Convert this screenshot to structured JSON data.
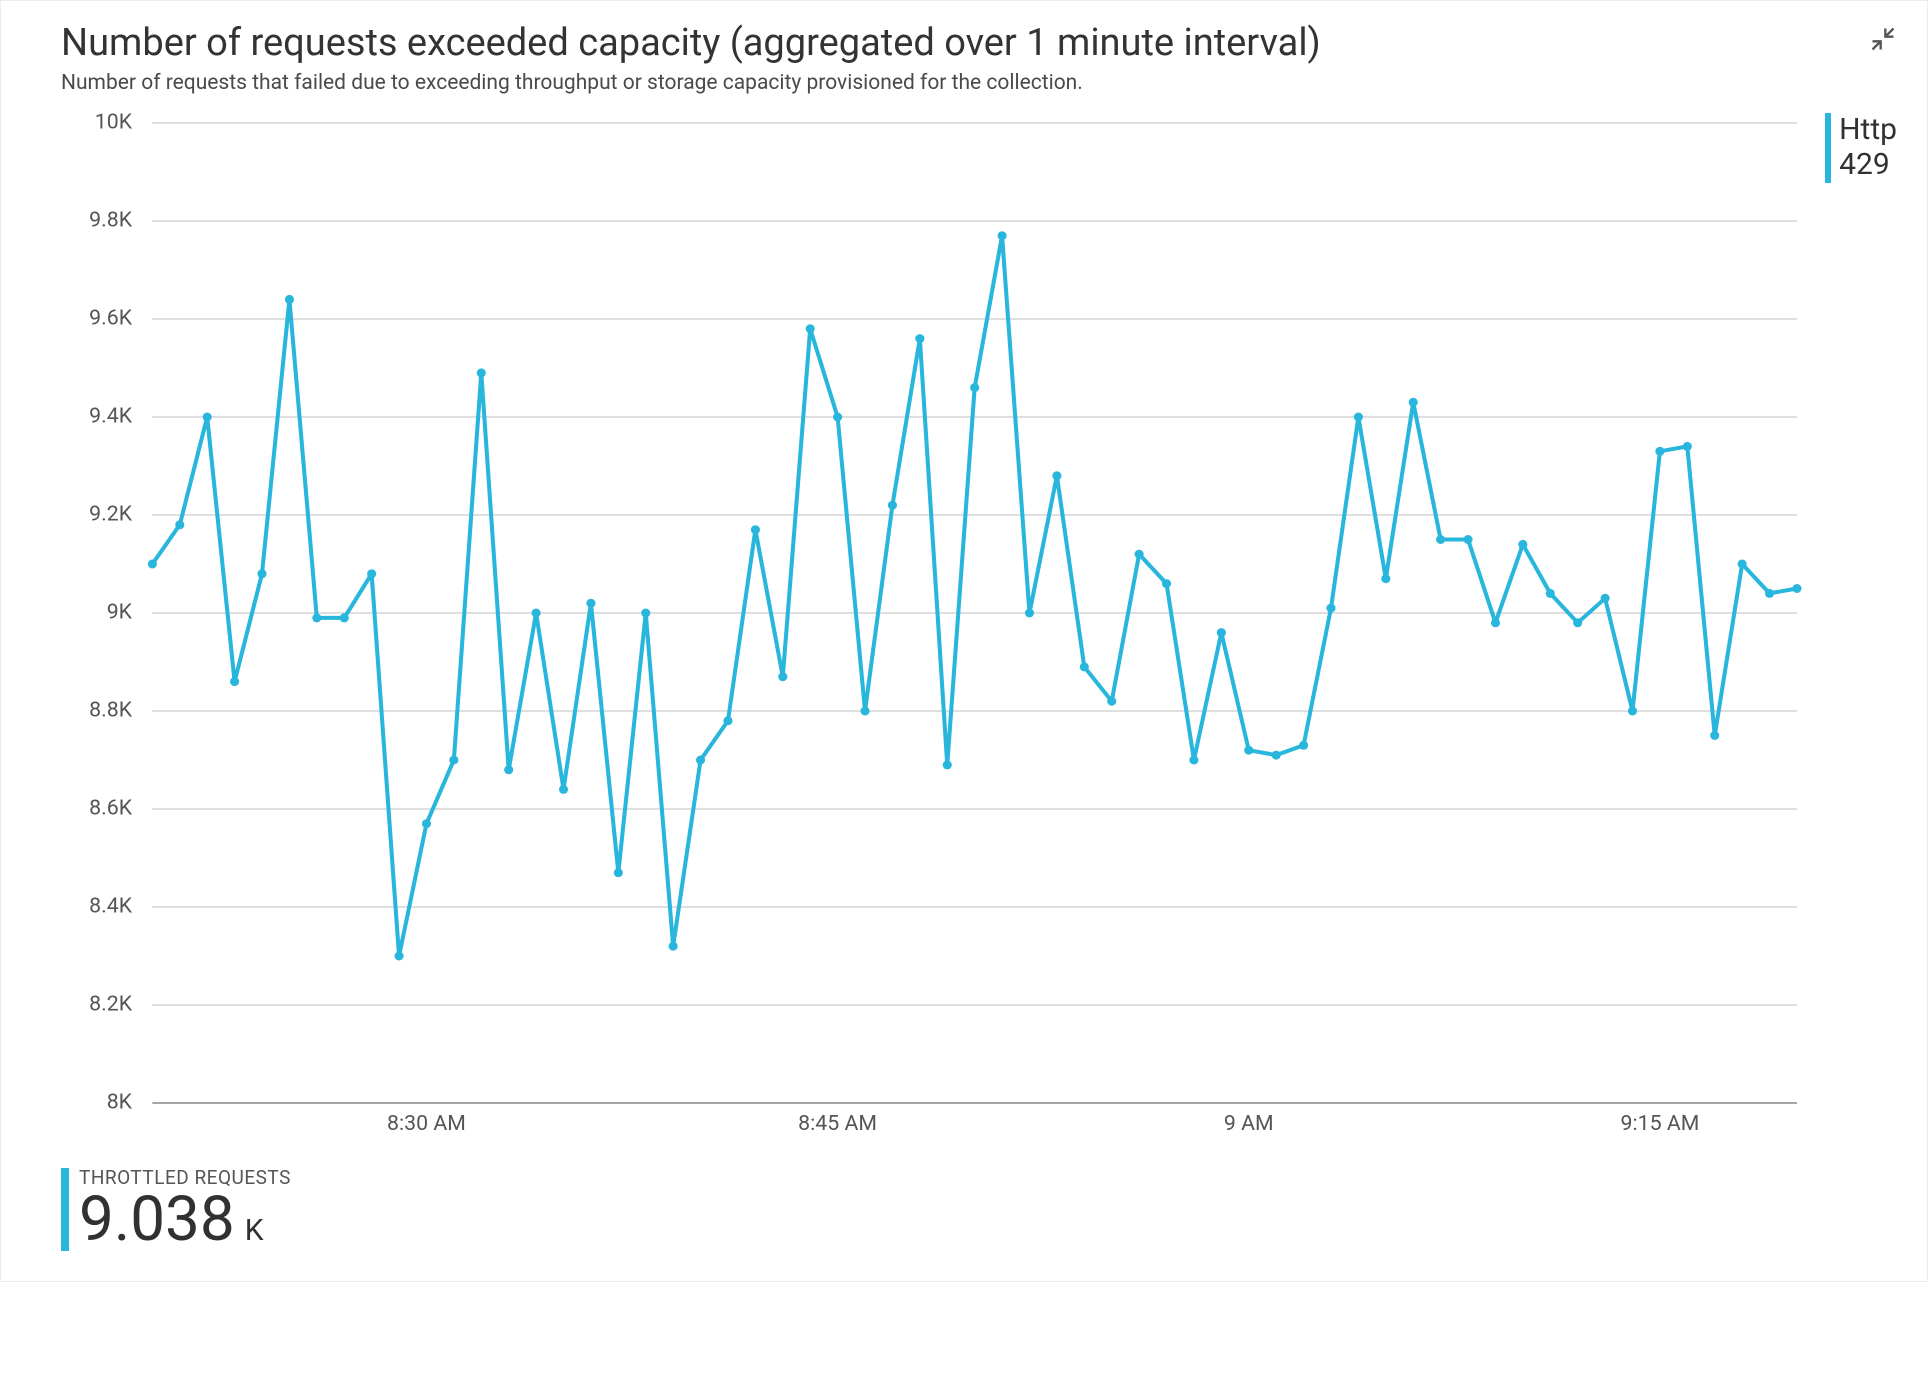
{
  "header": {
    "title": "Number of requests exceeded capacity (aggregated over 1 minute interval)",
    "subtitle": "Number of requests that failed due to exceeding throughput or storage capacity provisioned for the collection."
  },
  "legend": {
    "line1": "Http",
    "line2": "429"
  },
  "metric": {
    "label": "THROTTLED REQUESTS",
    "value": "9.038",
    "unit": "K"
  },
  "chart_data": {
    "type": "line",
    "title": "Number of requests exceeded capacity (aggregated over 1 minute interval)",
    "ylabel": "",
    "xlabel": "",
    "y_ticks": [
      8000,
      8200,
      8400,
      8600,
      8800,
      9000,
      9200,
      9400,
      9600,
      9800,
      10000
    ],
    "y_tick_labels": [
      "8K",
      "8.2K",
      "8.4K",
      "8.6K",
      "8.8K",
      "9K",
      "9.2K",
      "9.4K",
      "9.6K",
      "9.8K",
      "10K"
    ],
    "ylim": [
      8000,
      10000
    ],
    "x_ticks_at_index": [
      10,
      25,
      40,
      55
    ],
    "x_tick_labels": [
      "8:30 AM",
      "8:45 AM",
      "9 AM",
      "9:15 AM"
    ],
    "series": [
      {
        "name": "Http 429",
        "color": "#29b6dd",
        "values": [
          9100,
          9180,
          9400,
          8860,
          9080,
          9640,
          8990,
          8990,
          9080,
          8300,
          8570,
          8700,
          9490,
          8680,
          9000,
          8640,
          9020,
          8470,
          9000,
          8320,
          8700,
          8780,
          9170,
          8870,
          9580,
          9400,
          8800,
          9220,
          9560,
          8690,
          9460,
          9770,
          9000,
          9280,
          8890,
          8820,
          9120,
          9060,
          8700,
          8960,
          8720,
          8710,
          8730,
          9010,
          9400,
          9070,
          9430,
          9150,
          9150,
          8980,
          9140,
          9040,
          8980,
          9030,
          8800,
          9330,
          9340,
          8750,
          9100,
          9040,
          9050
        ]
      }
    ]
  }
}
